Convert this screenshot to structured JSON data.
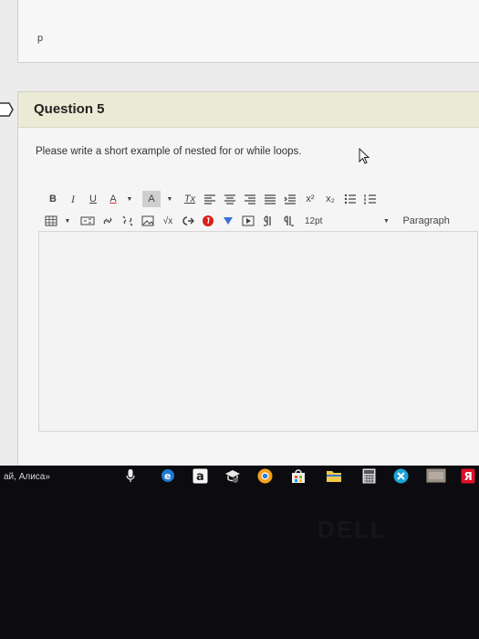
{
  "previous": {
    "answer_text": "p"
  },
  "question": {
    "title": "Question 5",
    "prompt": "Please write a short example of nested for or while loops."
  },
  "toolbar": {
    "bold": "B",
    "italic": "I",
    "underline": "U",
    "font_color": "A",
    "highlight": "A",
    "clear_format": "Tx",
    "superscript": "x²",
    "subscript": "x₂",
    "font_size": "12pt",
    "block_format": "Paragraph"
  },
  "editor": {
    "content": ""
  },
  "taskbar": {
    "search_text": "ай, Алиса»"
  },
  "brand": {
    "logo": "DELL"
  },
  "colors": {
    "header_bg": "#ebebd5",
    "edge_blue": "#1f78d1",
    "opera_red": "#e0102a",
    "chrome_orange": "#f4a11b"
  }
}
